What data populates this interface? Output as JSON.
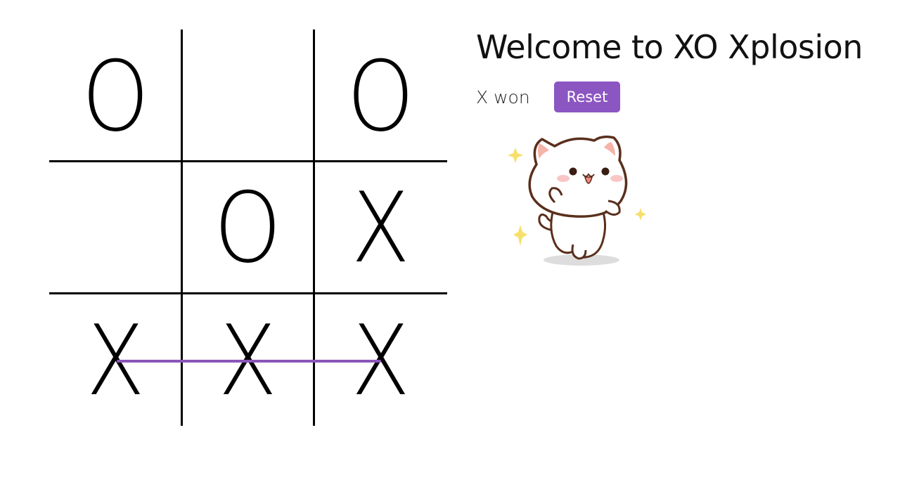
{
  "title": "Welcome to XO Xplosion",
  "status": "X won",
  "reset_label": "Reset",
  "board": {
    "cells": [
      "O",
      "",
      "O",
      "",
      "O",
      "X",
      "X",
      "X",
      "X"
    ],
    "winning_row": 3
  },
  "colors": {
    "accent": "#8b56c2",
    "win_line": "#8b56b8"
  },
  "sticker": {
    "icon": "cute-cat-sticker-icon"
  }
}
